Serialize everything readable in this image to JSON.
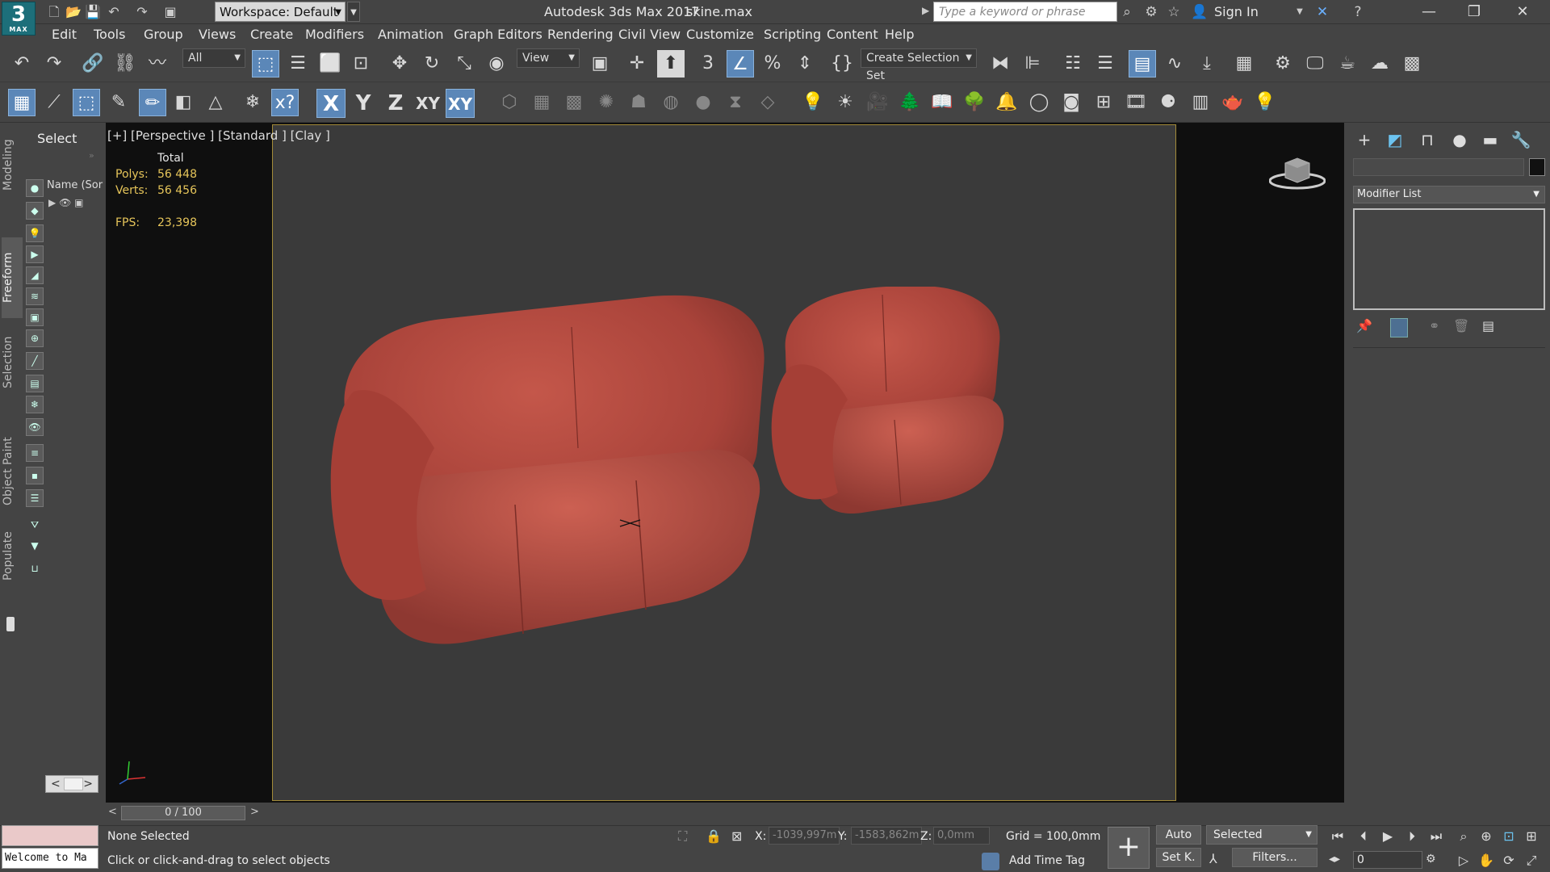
{
  "titlebar": {
    "logo_text": "3",
    "logo_sub": "MAX",
    "workspace": "Workspace: Default",
    "app_title": "Autodesk 3ds Max 2017",
    "filename": "skine.max",
    "search_placeholder": "Type a keyword or phrase",
    "sign_in": "Sign In"
  },
  "menu": [
    "Edit",
    "Tools",
    "Group",
    "Views",
    "Create",
    "Modifiers",
    "Animation",
    "Graph Editors",
    "Rendering",
    "Civil View",
    "Customize",
    "Scripting",
    "Content",
    "Help"
  ],
  "toolbar": {
    "filter_combo": "All",
    "ref_coord_combo": "View",
    "selection_set_combo": "Create Selection Set",
    "axis_labels": [
      "X",
      "Y",
      "Z",
      "XY",
      "XY"
    ]
  },
  "ribbon_tabs": [
    "Modeling",
    "Freeform",
    "Selection",
    "Object Paint",
    "Populate"
  ],
  "scene_explorer": {
    "select_label": "Select",
    "column_header": "Name (Sor",
    "scroll_left": "<",
    "scroll_right": ">"
  },
  "viewport": {
    "label": "[+] [Perspective ] [Standard ] [Clay ]",
    "stats_header": "Total",
    "polys_label": "Polys:",
    "polys_value": "56 448",
    "verts_label": "Verts:",
    "verts_value": "56 456",
    "fps_label": "FPS:",
    "fps_value": "23,398"
  },
  "timeline": {
    "frame_display": "0 / 100",
    "prev": "<",
    "next": ">"
  },
  "command_panel": {
    "modifier_list": "Modifier List"
  },
  "statusbar": {
    "maxscript_text": "Welcome to Ma",
    "selection_status": "None Selected",
    "hint": "Click or click-and-drag to select objects",
    "x_label": "X:",
    "x_value": "-1039,997m",
    "y_label": "Y:",
    "y_value": "-1583,862m",
    "z_label": "Z:",
    "z_value": "0,0mm",
    "grid": "Grid = 100,0mm",
    "add_time_tag": "Add Time Tag",
    "auto_key": "Auto",
    "set_key": "Set K.",
    "key_filter_combo": "Selected",
    "filters": "Filters...",
    "frame_spinner": "0"
  },
  "colors": {
    "sofa": "#b1453a",
    "viewport_bg": "#3a3a3a",
    "active_border": "#a38b39",
    "ui_bg": "#444444"
  }
}
